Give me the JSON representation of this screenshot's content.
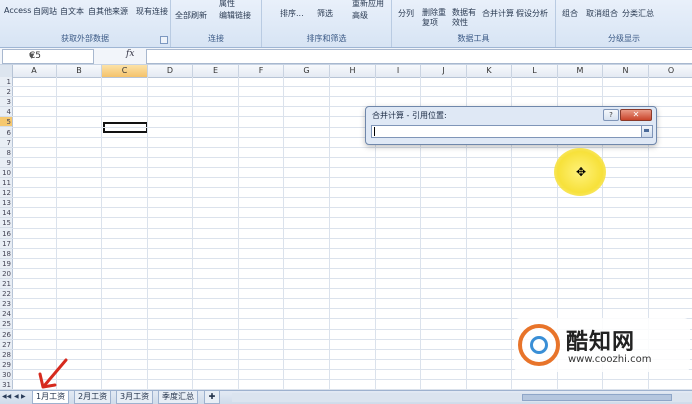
{
  "ribbon": {
    "groups": [
      {
        "label": "获取外部数据",
        "items": [
          "Access",
          "自网站",
          "自文本",
          "自其他来源",
          "现有连接"
        ]
      },
      {
        "label": "连接",
        "items": [
          "全部刷新",
          "属性",
          "编辑链接"
        ]
      },
      {
        "label": "排序和筛选",
        "items": [
          "排序...",
          "筛选",
          "重新应用",
          "高级"
        ]
      },
      {
        "label": "数据工具",
        "items": [
          "分列",
          "删除重复项",
          "数据有效性",
          "合并计算",
          "假设分析"
        ]
      },
      {
        "label": "分级显示",
        "items": [
          "组合",
          "取消组合",
          "分类汇总"
        ]
      }
    ]
  },
  "formula_bar": {
    "name_box": "C5",
    "fx_label": "fx",
    "formula": ""
  },
  "grid": {
    "columns": [
      "A",
      "B",
      "C",
      "D",
      "E",
      "F",
      "G",
      "H",
      "I",
      "J",
      "K",
      "L",
      "M",
      "N",
      "O"
    ],
    "rows": [
      "1",
      "2",
      "3",
      "4",
      "5",
      "6",
      "7",
      "8",
      "9",
      "10",
      "11",
      "12",
      "13",
      "14",
      "15",
      "16",
      "17",
      "18",
      "19",
      "20",
      "21",
      "22",
      "23",
      "24",
      "25",
      "26",
      "27",
      "28",
      "29",
      "30",
      "31"
    ],
    "selected_column": "C",
    "selected_row": "5"
  },
  "dialog": {
    "title": "合并计算 - 引用位置:",
    "help_label": "?",
    "close_label": "✕",
    "reference_value": ""
  },
  "watermark": {
    "name": "酷知网",
    "url": "www.coozhi.com"
  },
  "sheet_tabs": [
    "1月工资",
    "2月工资",
    "3月工资",
    "季度汇总"
  ],
  "active_tab": "1月工资",
  "colors": {
    "ribbon_bg": "#dce7f5",
    "selection_header": "#f4c26b",
    "annotation_arrow": "#d62a1e",
    "cursor_highlight": "#f7e13a"
  }
}
